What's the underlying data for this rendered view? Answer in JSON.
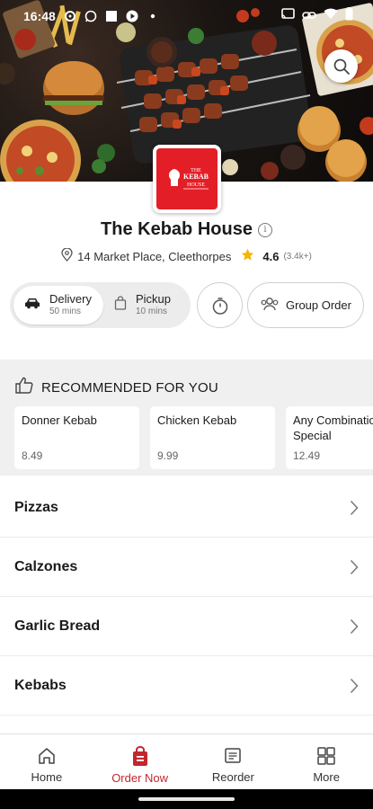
{
  "status_bar": {
    "time": "16:48",
    "left_icons": [
      "settings-icon",
      "whatsapp-icon",
      "square-icon",
      "play-icon",
      "dot-icon"
    ],
    "right_icons": [
      "cast-icon",
      "link-icon",
      "wifi-icon",
      "battery-icon"
    ]
  },
  "restaurant": {
    "name": "The Kebab House",
    "address": "14 Market Place, Cleethorpes",
    "rating": "4.6",
    "rating_count": "(3.4k+)",
    "logo_text_top": "THE",
    "logo_text_main": "KEBAB",
    "logo_text_sub": "HOUSE"
  },
  "order_mode": {
    "delivery": {
      "label": "Delivery",
      "time": "50 mins",
      "selected": true
    },
    "pickup": {
      "label": "Pickup",
      "time": "10 mins",
      "selected": false
    }
  },
  "group_order_label": "Group Order",
  "recommended": {
    "title": "RECOMMENDED FOR YOU",
    "items": [
      {
        "name": "Donner Kebab",
        "price": "8.49"
      },
      {
        "name": "Chicken Kebab",
        "price": "9.99"
      },
      {
        "name": "Any Combination Special",
        "price": "12.49"
      }
    ]
  },
  "categories": [
    "Pizzas",
    "Calzones",
    "Garlic Bread",
    "Kebabs"
  ],
  "bottom_nav": [
    {
      "label": "Home",
      "icon": "home-icon",
      "active": false
    },
    {
      "label": "Order Now",
      "icon": "order-bag-icon",
      "active": true
    },
    {
      "label": "Reorder",
      "icon": "receipt-icon",
      "active": false
    },
    {
      "label": "More",
      "icon": "grid-icon",
      "active": false
    }
  ],
  "colors": {
    "accent": "#c1272d",
    "logo_red": "#e41e26",
    "star": "#f4b400"
  }
}
